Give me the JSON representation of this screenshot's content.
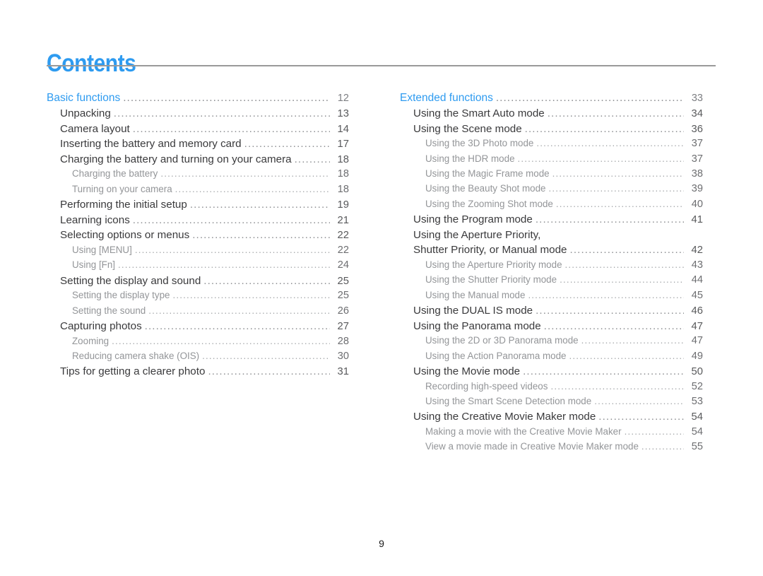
{
  "page": {
    "title": "Contents",
    "folio": "9",
    "accent_color": "#2e9bf0",
    "rule_color": "#9a9a9a",
    "level2_color": "#3a3a3c",
    "level3_color": "#939598",
    "background": "#ffffff"
  },
  "columns": {
    "left": {
      "entries": [
        {
          "level": 1,
          "label": "Basic functions",
          "page": "12"
        },
        {
          "level": 2,
          "label": "Unpacking",
          "page": "13"
        },
        {
          "level": 2,
          "label": "Camera layout",
          "page": "14"
        },
        {
          "level": 2,
          "label": "Inserting the battery and memory card",
          "page": "17"
        },
        {
          "level": 2,
          "label": "Charging the battery and turning on your camera",
          "page": "18"
        },
        {
          "level": 3,
          "label": "Charging the battery",
          "page": "18"
        },
        {
          "level": 3,
          "label": "Turning on your camera",
          "page": "18"
        },
        {
          "level": 2,
          "label": "Performing the initial setup",
          "page": "19"
        },
        {
          "level": 2,
          "label": "Learning icons",
          "page": "21"
        },
        {
          "level": 2,
          "label": "Selecting options or menus",
          "page": "22"
        },
        {
          "level": 3,
          "label": "Using [MENU]",
          "page": "22"
        },
        {
          "level": 3,
          "label": "Using [Fn]",
          "page": "24"
        },
        {
          "level": 2,
          "label": "Setting the display and sound",
          "page": "25"
        },
        {
          "level": 3,
          "label": "Setting the display type",
          "page": "25"
        },
        {
          "level": 3,
          "label": "Setting the sound",
          "page": "26"
        },
        {
          "level": 2,
          "label": "Capturing photos",
          "page": "27"
        },
        {
          "level": 3,
          "label": "Zooming",
          "page": "28"
        },
        {
          "level": 3,
          "label": "Reducing camera shake (OIS)",
          "page": "30"
        },
        {
          "level": 2,
          "label": "Tips for getting a clearer photo",
          "page": "31"
        }
      ]
    },
    "right": {
      "entries": [
        {
          "level": 1,
          "label": "Extended functions",
          "page": "33"
        },
        {
          "level": 2,
          "label": "Using the Smart Auto mode",
          "page": "34"
        },
        {
          "level": 2,
          "label": "Using the Scene mode",
          "page": "36"
        },
        {
          "level": 3,
          "label": "Using the 3D Photo mode",
          "page": "37"
        },
        {
          "level": 3,
          "label": "Using the HDR mode",
          "page": "37"
        },
        {
          "level": 3,
          "label": "Using the Magic Frame mode",
          "page": "38"
        },
        {
          "level": 3,
          "label": "Using the Beauty Shot mode",
          "page": "39"
        },
        {
          "level": 3,
          "label": "Using the Zooming Shot mode",
          "page": "40"
        },
        {
          "level": 2,
          "label": "Using the Program mode",
          "page": "41"
        },
        {
          "level": 2,
          "label": "Using the Aperture Priority,",
          "page": "",
          "continuation": true
        },
        {
          "level": 2,
          "label": "Shutter Priority, or Manual mode",
          "page": "42"
        },
        {
          "level": 3,
          "label": "Using the Aperture Priority mode",
          "page": "43"
        },
        {
          "level": 3,
          "label": "Using the Shutter Priority mode",
          "page": "44"
        },
        {
          "level": 3,
          "label": "Using the Manual mode",
          "page": "45"
        },
        {
          "level": 2,
          "label": "Using the DUAL IS mode",
          "page": "46"
        },
        {
          "level": 2,
          "label": "Using the Panorama mode",
          "page": "47"
        },
        {
          "level": 3,
          "label": "Using the 2D or 3D Panorama mode",
          "page": "47"
        },
        {
          "level": 3,
          "label": "Using the Action Panorama mode",
          "page": "49"
        },
        {
          "level": 2,
          "label": "Using the Movie mode",
          "page": "50"
        },
        {
          "level": 3,
          "label": "Recording high-speed videos",
          "page": "52"
        },
        {
          "level": 3,
          "label": "Using the Smart Scene Detection mode",
          "page": "53"
        },
        {
          "level": 2,
          "label": "Using the Creative Movie Maker mode",
          "page": "54"
        },
        {
          "level": 3,
          "label": "Making a movie with the Creative Movie Maker",
          "page": "54"
        },
        {
          "level": 3,
          "label": "View a movie made in Creative Movie Maker mode",
          "page": "55"
        }
      ]
    }
  }
}
